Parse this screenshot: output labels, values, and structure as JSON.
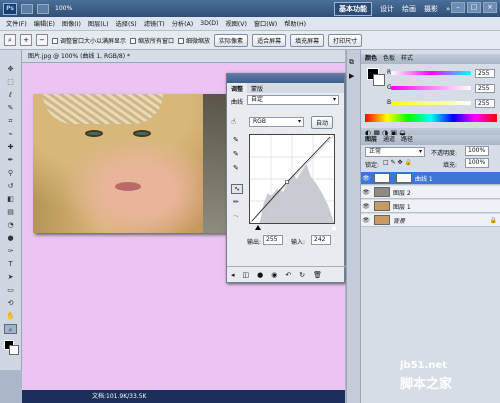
{
  "app": {
    "logo": "Ps",
    "zoom": "100%"
  },
  "workspace": {
    "items": [
      "基本功能",
      "设计",
      "绘画",
      "摄影",
      "»"
    ],
    "search_icon": "search-icon"
  },
  "menu": [
    "文件(F)",
    "编辑(E)",
    "图像(I)",
    "图层(L)",
    "选择(S)",
    "滤镜(T)",
    "分析(A)",
    "3D(D)",
    "视图(V)",
    "窗口(W)",
    "帮助(H)"
  ],
  "options": {
    "resize": "调整窗口大小以满屏显示",
    "zoom_all": "缩放所有窗口",
    "scrubby": "细微缩放",
    "actual": "实际像素",
    "fit": "适合屏幕",
    "fill": "填充屏幕",
    "print": "打印尺寸"
  },
  "document": {
    "tab": "图片.jpg @ 100% (曲线 1, RGB/8) *",
    "status": "文档:101.9K/33.5K"
  },
  "curves": {
    "tabs": [
      "调整",
      "蒙版"
    ],
    "label": "曲线",
    "preset": "自定",
    "channel": "RGB",
    "auto": "自动",
    "output_label": "输出:",
    "output_value": "255",
    "input_label": "输入:",
    "input_value": "242"
  },
  "color_panel": {
    "tabs": [
      "颜色",
      "色板",
      "样式"
    ],
    "channels": [
      {
        "label": "R",
        "value": "255",
        "grad": "#ff0000"
      },
      {
        "label": "G",
        "value": "255",
        "grad": "#00ff00"
      },
      {
        "label": "B",
        "value": "255",
        "grad": "#0000ff"
      }
    ]
  },
  "layers_panel": {
    "tabs": [
      "图层",
      "通道",
      "路径"
    ],
    "blend": "正常",
    "opacity_label": "不透明度:",
    "opacity": "100%",
    "lock_label": "锁定:",
    "fill_label": "填充:",
    "fill": "100%",
    "layers": [
      "曲线 1",
      "图层 2",
      "图层 1",
      "背景"
    ]
  },
  "watermark": {
    "site": "jb51.net",
    "name": "脚本之家"
  }
}
